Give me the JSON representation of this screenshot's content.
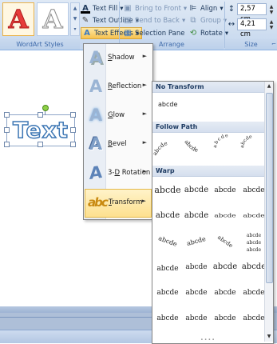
{
  "ribbon": {
    "wordart_styles": {
      "label": "WordArt Styles",
      "style_glyph_1": "A",
      "style_glyph_2": "A",
      "text_fill": "Text Fill",
      "text_outline": "Text Outline",
      "text_effects": "Text Effects"
    },
    "arrange": {
      "label": "Arrange",
      "bring_to_front": "Bring to Front",
      "send_to_back": "Send to Back",
      "selection_pane": "Selection Pane",
      "align": "Align",
      "group": "Group",
      "rotate": "Rotate"
    },
    "size": {
      "label": "Size",
      "height": "2,57 cm",
      "width": "4,21 cm"
    }
  },
  "document": {
    "wordart_text": "Text"
  },
  "text_effects_menu": {
    "items": [
      {
        "label": "Shadow",
        "accel": "S",
        "rest": "hadow"
      },
      {
        "label": "Reflection",
        "accel": "R",
        "rest": "eflection"
      },
      {
        "label": "Glow",
        "accel": "G",
        "rest": "low"
      },
      {
        "label": "Bevel",
        "accel": "B",
        "rest": "evel"
      },
      {
        "label": "3-D Rotation",
        "pre": "3-",
        "accel": "D",
        "rest": " Rotation"
      },
      {
        "label": "Transform",
        "accel": "T",
        "rest": "ransform"
      }
    ],
    "selected": "Transform"
  },
  "transform_gallery": {
    "sections": {
      "no_transform": "No Transform",
      "follow_path": "Follow Path",
      "warp": "Warp"
    },
    "no_transform_sample": "abcde",
    "sample_text": "abcde"
  }
}
